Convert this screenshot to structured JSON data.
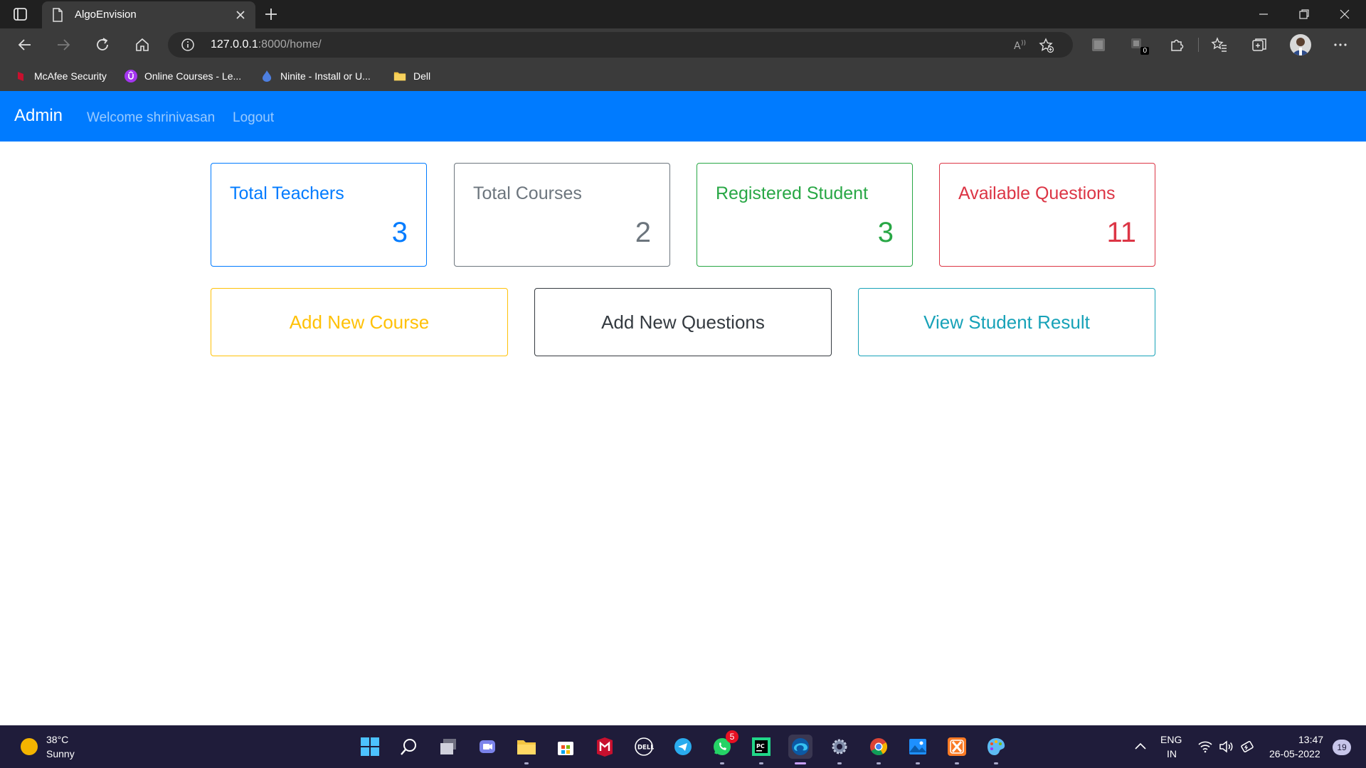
{
  "browser": {
    "tab_title": "AlgoEnvision",
    "url_host": "127.0.0.1",
    "url_path": ":8000/home/",
    "bookmarks": [
      {
        "label": "McAfee Security",
        "icon": "mcafee-icon",
        "color": "#c8102e"
      },
      {
        "label": "Online Courses - Le...",
        "icon": "udemy-icon",
        "color": "#a435f0"
      },
      {
        "label": "Ninite - Install or U...",
        "icon": "ninite-icon",
        "color": "#4d7fe0"
      },
      {
        "label": "Dell",
        "icon": "folder-icon",
        "color": "#f4c542"
      }
    ],
    "extension_badge": "0"
  },
  "navbar": {
    "brand": "Admin",
    "welcome": "Welcome shrinivasan",
    "logout": "Logout",
    "color": "#007bff"
  },
  "stats": [
    {
      "title": "Total Teachers",
      "value": "3",
      "color": "#007bff"
    },
    {
      "title": "Total Courses",
      "value": "2",
      "color": "#6c757d"
    },
    {
      "title": "Registered Student",
      "value": "3",
      "color": "#28a745"
    },
    {
      "title": "Available Questions",
      "value": "11",
      "color": "#dc3545"
    }
  ],
  "actions": [
    {
      "label": "Add New Course",
      "color": "#ffc107"
    },
    {
      "label": "Add New Questions",
      "color": "#343a40"
    },
    {
      "label": "View Student Result",
      "color": "#17a2b8"
    }
  ],
  "taskbar": {
    "temperature": "38°C",
    "condition": "Sunny",
    "whatsapp_badge": "5",
    "lang_top": "ENG",
    "lang_bottom": "IN",
    "time": "13:47",
    "date": "26-05-2022",
    "notifications": "19"
  }
}
